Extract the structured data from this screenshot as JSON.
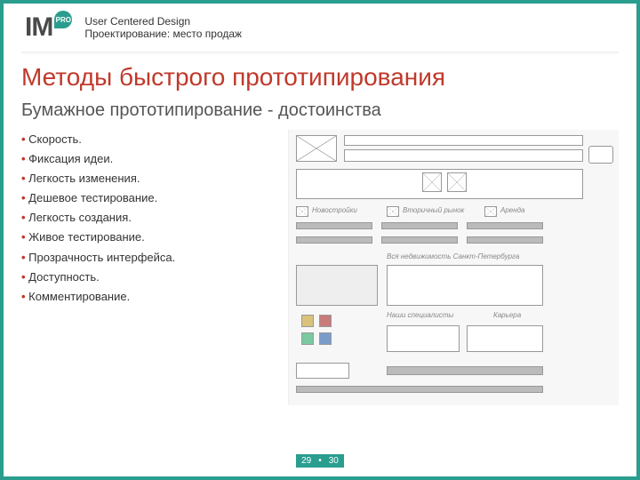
{
  "header": {
    "logo_text": "IM",
    "logo_badge": "PRO",
    "line1": "User Centered Design",
    "line2": "Проектирование: место продаж"
  },
  "title": "Методы быстрого прототипирования",
  "subtitle": "Бумажное прототипирование - достоинства",
  "bullets": [
    "Скорость.",
    "Фиксация идеи.",
    "Легкость изменения.",
    "Дешевое тестирование.",
    "Легкость создания.",
    "Живое тестирование.",
    "Прозрачность интерфейса.",
    "Доступность.",
    "Комментирование."
  ],
  "sketch_labels": {
    "section1": "Новостройки",
    "section2": "Вторичный рынок",
    "section3": "Аренда",
    "big_caption": "Вся недвижимость Санкт-Петербурга",
    "col1": "Наши специалисты",
    "col2": "Карьера"
  },
  "footer": {
    "page_current": "29",
    "page_dot": "•",
    "page_total": "30"
  }
}
